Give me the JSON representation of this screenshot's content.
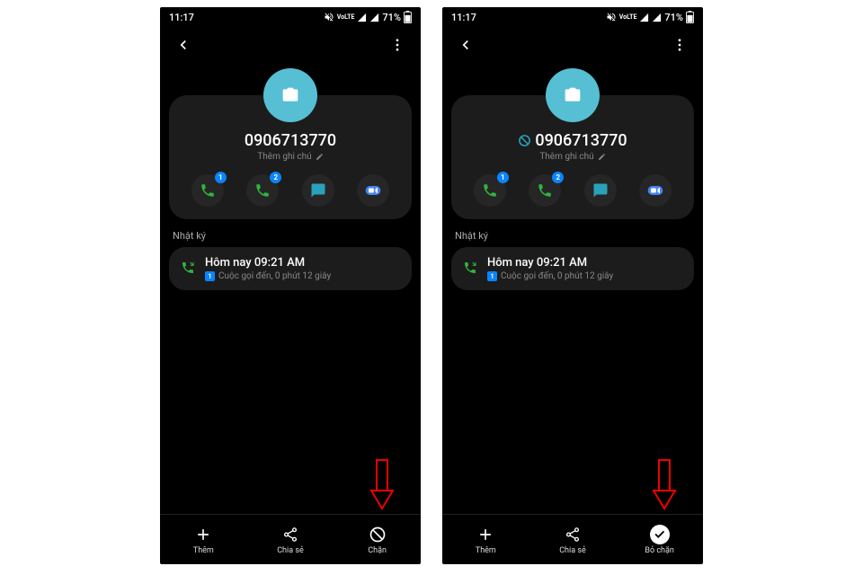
{
  "status": {
    "time": "11:17",
    "battery": "71%",
    "volte": "VoLTE"
  },
  "contact": {
    "phone": "0906713770",
    "add_note": "Thêm ghi chú",
    "call1_badge": "1",
    "call2_badge": "2"
  },
  "section": {
    "log": "Nhật ký"
  },
  "log_entry": {
    "time": "Hôm nay 09:21 AM",
    "sim": "1",
    "detail": "Cuộc gọi đến, 0 phút 12 giây"
  },
  "bottom": {
    "add": "Thêm",
    "share": "Chia sẻ",
    "block": "Chặn",
    "unblock": "Bỏ chặn"
  },
  "left_phone": {
    "blocked": false
  },
  "right_phone": {
    "blocked": true
  }
}
